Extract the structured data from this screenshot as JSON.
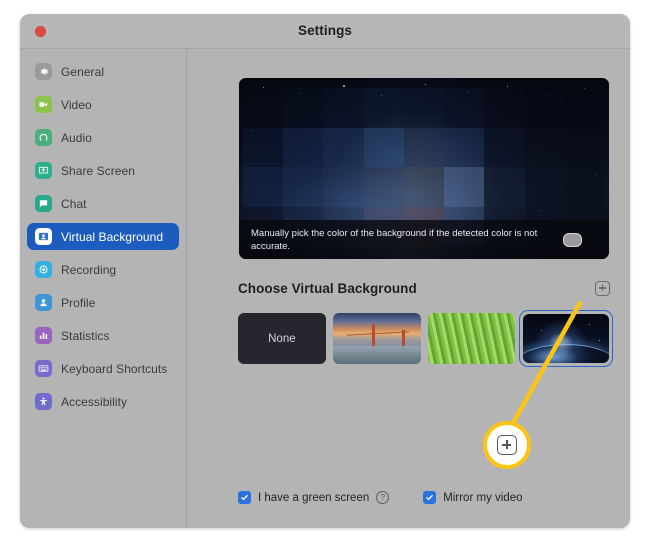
{
  "window": {
    "title": "Settings",
    "close_button": "close"
  },
  "sidebar": {
    "items": [
      {
        "label": "General",
        "icon": "gear-icon",
        "color": "#9b9b9b",
        "selected": false
      },
      {
        "label": "Video",
        "icon": "video-camera-icon",
        "color": "#8cc34a",
        "selected": false
      },
      {
        "label": "Audio",
        "icon": "headphones-icon",
        "color": "#4caf7d",
        "selected": false
      },
      {
        "label": "Share Screen",
        "icon": "share-screen-icon",
        "color": "#2fae8e",
        "selected": false
      },
      {
        "label": "Chat",
        "icon": "chat-bubble-icon",
        "color": "#27a88f",
        "selected": false
      },
      {
        "label": "Virtual Background",
        "icon": "virtual-background-icon",
        "color": "#2f6fd0",
        "selected": true
      },
      {
        "label": "Recording",
        "icon": "record-icon",
        "color": "#35b0de",
        "selected": false
      },
      {
        "label": "Profile",
        "icon": "person-icon",
        "color": "#3f96d6",
        "selected": false
      },
      {
        "label": "Statistics",
        "icon": "bar-chart-icon",
        "color": "#9b63c0",
        "selected": false
      },
      {
        "label": "Keyboard Shortcuts",
        "icon": "keyboard-icon",
        "color": "#7a6ac9",
        "selected": false
      },
      {
        "label": "Accessibility",
        "icon": "accessibility-icon",
        "color": "#6f6cce",
        "selected": false
      }
    ],
    "selected_color": "#1d5cbf"
  },
  "main": {
    "preview": {
      "banner_text": "Manually pick the color of the background if the detected color is not accurate.",
      "color_swatch": "color-picker-swatch"
    },
    "choose_heading": "Choose Virtual Background",
    "add_button": "add-background-button",
    "thumbnails": [
      {
        "label": "None",
        "name": "background-none",
        "selected": false
      },
      {
        "label": "Golden Gate Bridge",
        "name": "background-bridge",
        "selected": false
      },
      {
        "label": "Grass",
        "name": "background-grass",
        "selected": false
      },
      {
        "label": "Earth from Space",
        "name": "background-earth",
        "selected": true
      }
    ],
    "options": [
      {
        "label": "I have a green screen",
        "checked": true,
        "help": "?"
      },
      {
        "label": "Mirror my video",
        "checked": true
      }
    ]
  },
  "callout": {
    "target": "add-background-button",
    "icon": "plus-icon",
    "ring_color": "#fdc513"
  }
}
